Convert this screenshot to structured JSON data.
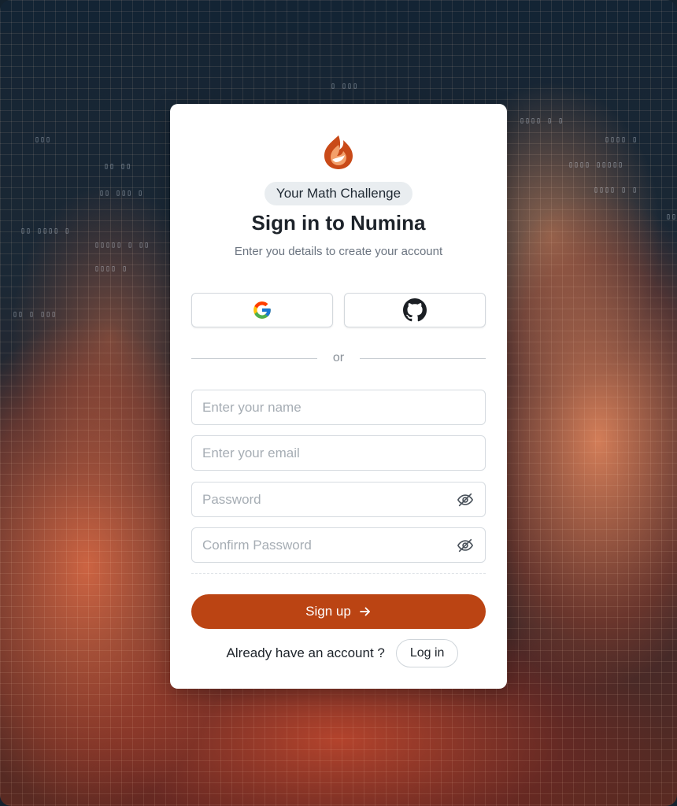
{
  "background": {
    "description_color": "#14222e"
  },
  "brand": {
    "accent_color": "#bb4413",
    "logo_icon": "flame-logo-icon"
  },
  "card": {
    "badge": "Your Math Challenge",
    "title": "Sign in to Numina",
    "subtitle": "Enter you details to create your account"
  },
  "social": {
    "google_icon": "google-icon",
    "github_icon": "github-icon"
  },
  "divider": {
    "label": "or"
  },
  "form": {
    "name_placeholder": "Enter your name",
    "email_placeholder": "Enter your email",
    "password_placeholder": "Password",
    "confirm_password_placeholder": "Confirm Password",
    "password_toggle_icon": "eye-off-icon"
  },
  "actions": {
    "signup_label": "Sign up",
    "signup_icon": "arrow-right-icon",
    "login_prompt": "Already have an account ?",
    "login_label": "Log in"
  }
}
